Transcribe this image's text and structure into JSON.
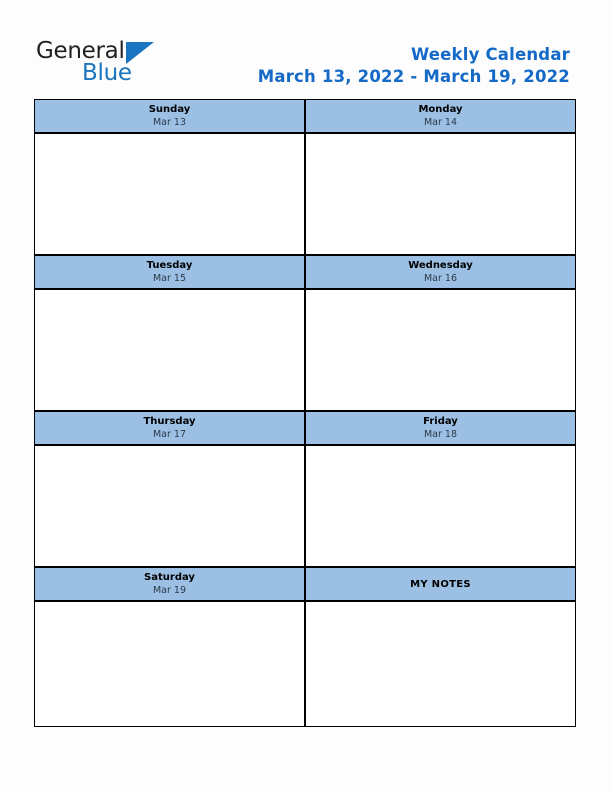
{
  "brand": {
    "name_part1": "General",
    "name_part2": "Blue",
    "flag_icon": "triangle-flag-icon",
    "accent_color": "#1a74c0"
  },
  "header": {
    "title": "Weekly Calendar",
    "date_range": "March 13, 2022 - March 19, 2022",
    "title_color": "#1569c7"
  },
  "calendar": {
    "header_bg_color": "#9cc0e4",
    "border_color": "#000000",
    "body_bg_color": "#ffffff",
    "weeks": [
      {
        "left": {
          "day": "Sunday",
          "date": "Mar 13",
          "note": ""
        },
        "right": {
          "day": "Monday",
          "date": "Mar 14",
          "note": ""
        }
      },
      {
        "left": {
          "day": "Tuesday",
          "date": "Mar 15",
          "note": ""
        },
        "right": {
          "day": "Wednesday",
          "date": "Mar 16",
          "note": ""
        }
      },
      {
        "left": {
          "day": "Thursday",
          "date": "Mar 17",
          "note": ""
        },
        "right": {
          "day": "Friday",
          "date": "Mar 18",
          "note": ""
        }
      },
      {
        "left": {
          "day": "Saturday",
          "date": "Mar 19",
          "note": ""
        },
        "right": {
          "day": "MY NOTES",
          "date": "",
          "note": ""
        }
      }
    ]
  }
}
